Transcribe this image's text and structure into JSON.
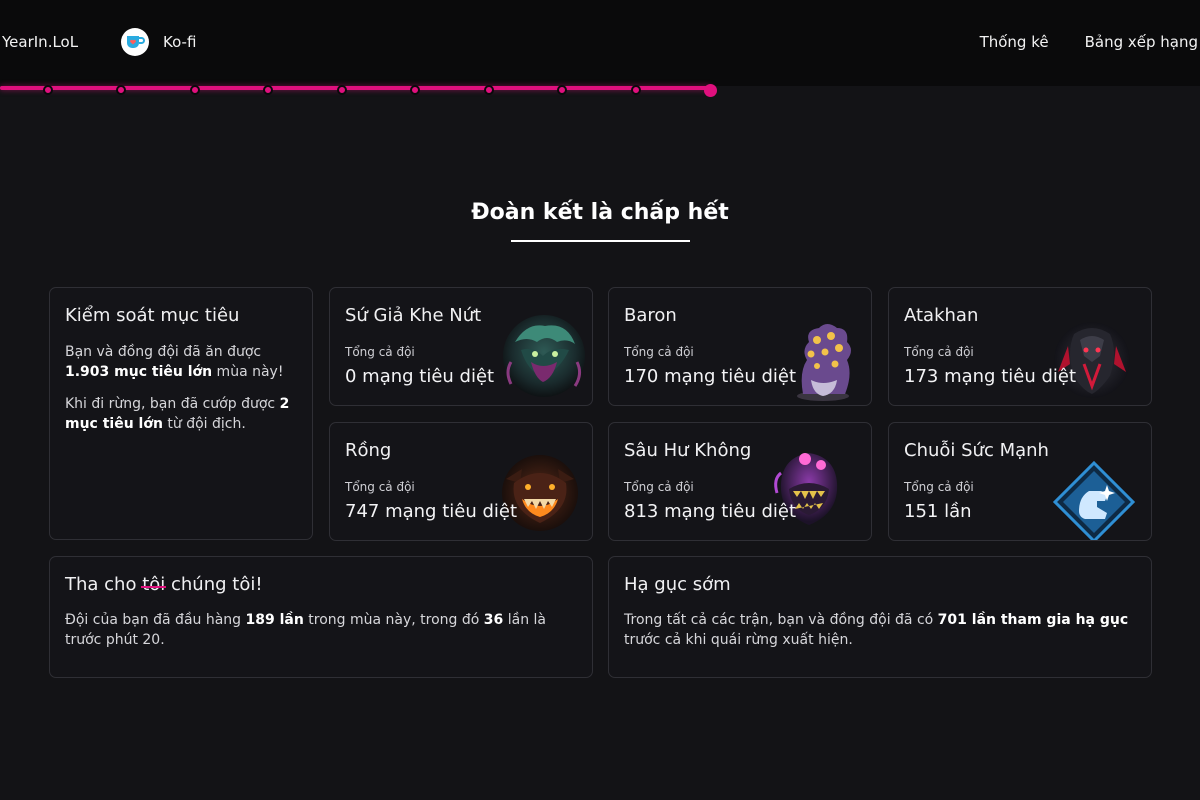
{
  "nav": {
    "brand": "YearIn.LoL",
    "kofi": "Ko-fi",
    "links": [
      "Thống kê",
      "Bảng xếp hạng"
    ]
  },
  "progress": {
    "steps_total": 10,
    "current_step": 10,
    "accent": "#e0107e"
  },
  "section": {
    "title": "Đoàn kết là chấp hết"
  },
  "objectives": {
    "title": "Kiểm soát mục tiêu",
    "p1_before": "Bạn và đồng đội đã ăn được ",
    "p1_bold": "1.903 mục tiêu lớn",
    "p1_after": " mùa này!",
    "p2_before": "Khi đi rừng, bạn đã cướp được ",
    "p2_bold": "2 mục tiêu lớn",
    "p2_after": " từ đội địch."
  },
  "stats": [
    {
      "title": "Sứ Giả Khe Nứt",
      "sub": "Tổng cả đội",
      "value": "0 mạng tiêu diệt",
      "icon": "rift-herald-icon"
    },
    {
      "title": "Baron",
      "sub": "Tổng cả đội",
      "value": "170 mạng tiêu diệt",
      "icon": "baron-icon"
    },
    {
      "title": "Atakhan",
      "sub": "Tổng cả đội",
      "value": "173 mạng tiêu diệt",
      "icon": "atakhan-icon"
    },
    {
      "title": "Rồng",
      "sub": "Tổng cả đội",
      "value": "747 mạng tiêu diệt",
      "icon": "dragon-icon"
    },
    {
      "title": "Sâu Hư Không",
      "sub": "Tổng cả đội",
      "value": "813 mạng tiêu diệt",
      "icon": "voidgrub-icon"
    },
    {
      "title": "Chuỗi Sức Mạnh",
      "sub": "Tổng cả đội",
      "value": "151 lần",
      "icon": "power-streak-icon"
    }
  ],
  "surrender": {
    "title_before": "Tha cho ",
    "title_struck": "tôi",
    "title_after": " chúng tôi!",
    "before": "Đội của bạn đã đầu hàng ",
    "bold1": "189 lần",
    "middle": " trong mùa này, trong đó ",
    "bold2": "36",
    "after": " lần là trước phút 20."
  },
  "early": {
    "title": "Hạ gục sớm",
    "before": "Trong tất cả các trận, bạn và đồng đội đã có ",
    "bold": "701 lần tham gia hạ gục",
    "after": " trước cả khi quái rừng xuất hiện."
  }
}
